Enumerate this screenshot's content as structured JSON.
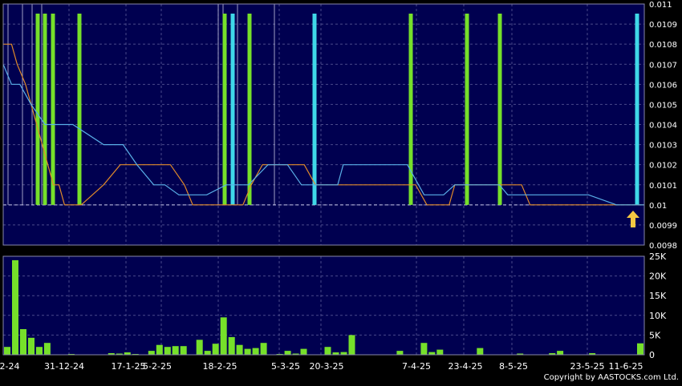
{
  "chart_data": [
    {
      "type": "line",
      "title": "",
      "ylim": [
        0.0098,
        0.011
      ],
      "y_ticks": [
        "0.011",
        "0.0109",
        "0.0108",
        "0.0107",
        "0.0106",
        "0.0105",
        "0.0104",
        "0.0103",
        "0.0102",
        "0.0101",
        "0.01",
        "0.0099",
        "0.0098"
      ],
      "reference_level": 0.01,
      "grid": true,
      "series": [
        {
          "color": "#e08a2a",
          "points": [
            [
              0,
              0.0108
            ],
            [
              6,
              0.0108
            ],
            [
              10,
              0.0107
            ],
            [
              16,
              0.0106
            ],
            [
              24,
              0.0104
            ],
            [
              32,
              0.0102
            ],
            [
              36,
              0.0101
            ],
            [
              40,
              0.0101
            ],
            [
              44,
              0.01
            ],
            [
              48,
              0.01
            ],
            [
              56,
              0.01
            ],
            [
              72,
              0.0101
            ],
            [
              84,
              0.0102
            ],
            [
              120,
              0.0102
            ],
            [
              130,
              0.0101
            ],
            [
              136,
              0.01
            ],
            [
              152,
              0.01
            ],
            [
              172,
              0.01
            ],
            [
              178,
              0.0101
            ],
            [
              186,
              0.0102
            ],
            [
              204,
              0.0102
            ],
            [
              216,
              0.0102
            ],
            [
              224,
              0.0101
            ],
            [
              262,
              0.0101
            ],
            [
              296,
              0.0101
            ],
            [
              304,
              0.01
            ],
            [
              320,
              0.01
            ],
            [
              324,
              0.0101
            ],
            [
              360,
              0.0101
            ],
            [
              372,
              0.0101
            ],
            [
              378,
              0.01
            ],
            [
              436,
              0.01
            ],
            [
              460,
              0.01
            ]
          ]
        },
        {
          "color": "#5ab0e8",
          "points": [
            [
              0,
              0.0107
            ],
            [
              6,
              0.0106
            ],
            [
              12,
              0.0106
            ],
            [
              20,
              0.0105
            ],
            [
              30,
              0.0104
            ],
            [
              50,
              0.0104
            ],
            [
              72,
              0.0103
            ],
            [
              86,
              0.0103
            ],
            [
              96,
              0.0102
            ],
            [
              108,
              0.0101
            ],
            [
              116,
              0.0101
            ],
            [
              126,
              0.01005
            ],
            [
              146,
              0.01005
            ],
            [
              160,
              0.0101
            ],
            [
              168,
              0.0101
            ],
            [
              176,
              0.0101
            ],
            [
              190,
              0.0102
            ],
            [
              204,
              0.0102
            ],
            [
              214,
              0.0101
            ],
            [
              226,
              0.0101
            ],
            [
              240,
              0.0101
            ],
            [
              244,
              0.0102
            ],
            [
              264,
              0.0102
            ],
            [
              290,
              0.0102
            ],
            [
              302,
              0.01005
            ],
            [
              316,
              0.01005
            ],
            [
              324,
              0.0101
            ],
            [
              356,
              0.0101
            ],
            [
              362,
              0.01005
            ],
            [
              380,
              0.01005
            ],
            [
              420,
              0.01005
            ],
            [
              440,
              0.01
            ],
            [
              460,
              0.01
            ]
          ]
        }
      ],
      "markers": [
        {
          "x": 47,
          "color": "#76e02a"
        },
        {
          "x": 56,
          "color": "#76e02a"
        },
        {
          "x": 66,
          "color": "#76e02a"
        },
        {
          "x": 99,
          "color": "#76e02a"
        },
        {
          "x": 280,
          "color": "#76e02a"
        },
        {
          "x": 290,
          "color": "#3fd8e8"
        },
        {
          "x": 311,
          "color": "#76e02a"
        },
        {
          "x": 392,
          "color": "#3fd8e8"
        },
        {
          "x": 512,
          "color": "#76e02a"
        },
        {
          "x": 582,
          "color": "#76e02a"
        },
        {
          "x": 623,
          "color": "#76e02a"
        },
        {
          "x": 794,
          "color": "#3fd8e8"
        }
      ],
      "current_price_marker": {
        "color": "#f5c842",
        "icon": "up-arrow-icon"
      }
    },
    {
      "type": "bar",
      "ylim": [
        0,
        25000
      ],
      "y_ticks": [
        "25K",
        "20K",
        "15K",
        "10K",
        "5K",
        "0"
      ],
      "bar_color": "#76e02a",
      "values": [
        2000,
        24000,
        6500,
        4300,
        2000,
        3000,
        0,
        0,
        200,
        100,
        0,
        100,
        0,
        400,
        300,
        600,
        200,
        0,
        1000,
        2500,
        2000,
        2200,
        2200,
        0,
        3800,
        1000,
        2800,
        9500,
        4500,
        2500,
        1500,
        1700,
        3000,
        0,
        200,
        1000,
        300,
        1500,
        0,
        0,
        2000,
        600,
        700,
        5000,
        0,
        0,
        0,
        0,
        0,
        1000,
        0,
        0,
        3000,
        700,
        1300,
        0,
        0,
        0,
        0,
        1700,
        0,
        0,
        100,
        0,
        300,
        0,
        0,
        100,
        400,
        1000,
        0,
        0,
        0,
        400,
        0,
        0,
        0,
        0,
        0,
        2900
      ],
      "x_tick_labels": [
        "2-24",
        "31-12-24",
        "17-1-25",
        "5-2-25",
        "18-2-25",
        "5-3-25",
        "20-3-25",
        "7-4-25",
        "23-4-25",
        "8-5-25",
        "23-5-25",
        "11-6-25"
      ]
    }
  ],
  "copyright": "Copyright by AASTOCKS.com Ltd."
}
